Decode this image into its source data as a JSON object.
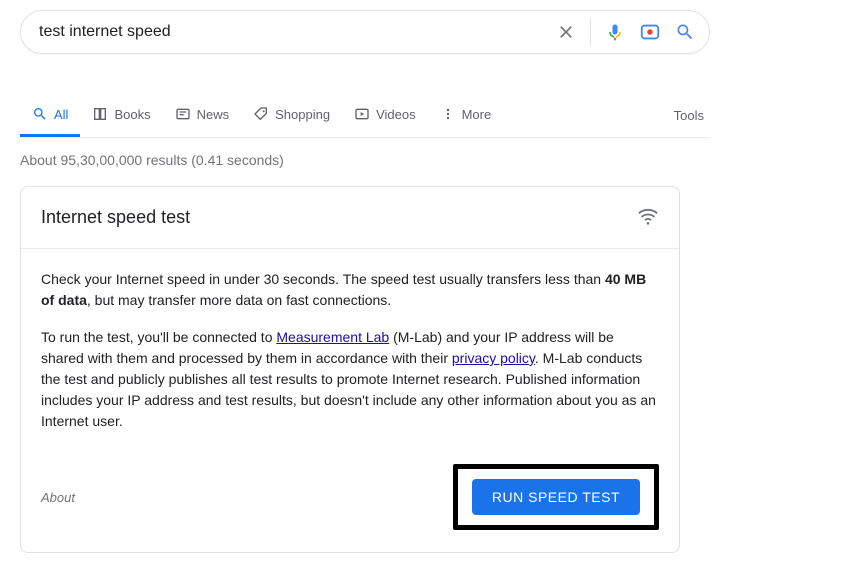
{
  "search": {
    "value": "test internet speed"
  },
  "tabs": {
    "all": "All",
    "books": "Books",
    "news": "News",
    "shopping": "Shopping",
    "videos": "Videos",
    "more": "More",
    "tools": "Tools"
  },
  "stats": "About 95,30,00,000 results (0.41 seconds)",
  "card": {
    "title": "Internet speed test",
    "p1_a": "Check your Internet speed in under 30 seconds. The speed test usually transfers less than ",
    "p1_b": "40 MB of data",
    "p1_c": ", but may transfer more data on fast connections.",
    "p2_a": "To run the test, you'll be connected to ",
    "link1": "Measurement Lab",
    "p2_b": " (M-Lab) and your IP address will be shared with them and processed by them in accordance with their ",
    "link2": "privacy policy",
    "p2_c": ". M-Lab conducts the test and publicly publishes all test results to promote Internet research. Published information includes your IP address and test results, but doesn't include any other information about you as an Internet user.",
    "about": "About",
    "run_btn": "RUN SPEED TEST"
  }
}
